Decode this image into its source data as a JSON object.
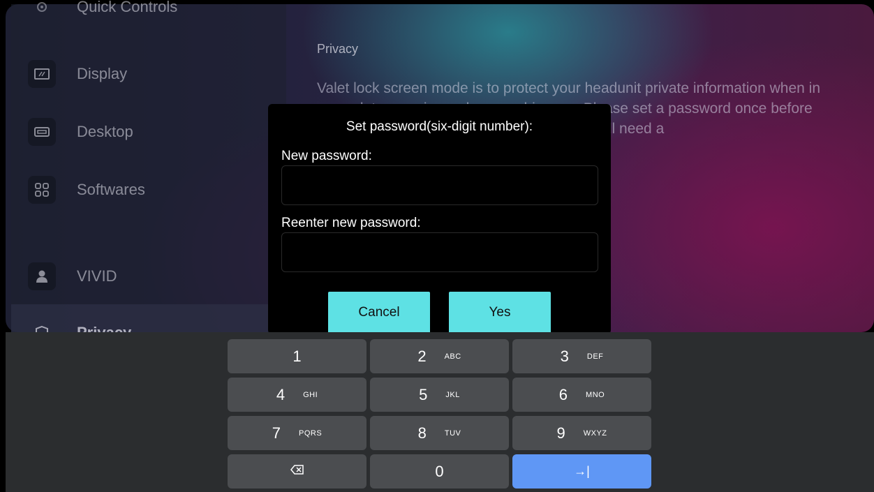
{
  "sidebar": {
    "items": [
      {
        "label": "Quick Controls",
        "icon": "gear-icon"
      },
      {
        "label": "Display",
        "icon": "display-icon"
      },
      {
        "label": "Desktop",
        "icon": "desktop-icon"
      },
      {
        "label": "Softwares",
        "icon": "apps-grid-icon"
      },
      {
        "label": "VIVID",
        "icon": "person-icon"
      },
      {
        "label": "Privacy",
        "icon": "shield-icon"
      }
    ]
  },
  "content": {
    "title": "Privacy",
    "description": "Valet lock screen mode is to protect your headunit private information when in any valet scenario, such as washing car, Please set a password once before using this feature, remember it or else you will need a"
  },
  "dialog": {
    "title": "Set password(six-digit number):",
    "new_password_label": "New password:",
    "new_password_value": "",
    "reenter_label": "Reenter new password:",
    "reenter_value": "",
    "cancel_label": "Cancel",
    "yes_label": "Yes"
  },
  "keyboard": {
    "keys": [
      {
        "num": "1",
        "letters": ""
      },
      {
        "num": "2",
        "letters": "ABC"
      },
      {
        "num": "3",
        "letters": "DEF"
      },
      {
        "num": "4",
        "letters": "GHI"
      },
      {
        "num": "5",
        "letters": "JKL"
      },
      {
        "num": "6",
        "letters": "MNO"
      },
      {
        "num": "7",
        "letters": "PQRS"
      },
      {
        "num": "8",
        "letters": "TUV"
      },
      {
        "num": "9",
        "letters": "WXYZ"
      },
      {
        "num": "0",
        "letters": ""
      }
    ],
    "backspace_icon": "backspace-icon",
    "next_glyph": "→|",
    "next_icon": "tab-next-icon"
  },
  "colors": {
    "dialog_button": "#5ee1e4",
    "enter_key": "#5f97f5",
    "key": "#4b4d50",
    "keyboard_bg": "#2b2d2f"
  }
}
